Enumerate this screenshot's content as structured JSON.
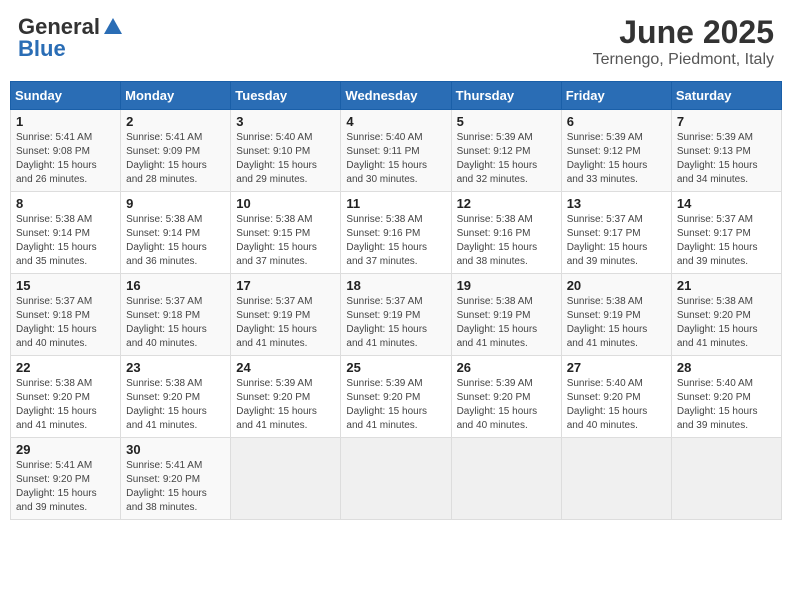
{
  "logo": {
    "general": "General",
    "blue": "Blue"
  },
  "title": "June 2025",
  "location": "Ternengo, Piedmont, Italy",
  "days_header": [
    "Sunday",
    "Monday",
    "Tuesday",
    "Wednesday",
    "Thursday",
    "Friday",
    "Saturday"
  ],
  "weeks": [
    [
      {
        "day": "1",
        "info": "Sunrise: 5:41 AM\nSunset: 9:08 PM\nDaylight: 15 hours\nand 26 minutes."
      },
      {
        "day": "2",
        "info": "Sunrise: 5:41 AM\nSunset: 9:09 PM\nDaylight: 15 hours\nand 28 minutes."
      },
      {
        "day": "3",
        "info": "Sunrise: 5:40 AM\nSunset: 9:10 PM\nDaylight: 15 hours\nand 29 minutes."
      },
      {
        "day": "4",
        "info": "Sunrise: 5:40 AM\nSunset: 9:11 PM\nDaylight: 15 hours\nand 30 minutes."
      },
      {
        "day": "5",
        "info": "Sunrise: 5:39 AM\nSunset: 9:12 PM\nDaylight: 15 hours\nand 32 minutes."
      },
      {
        "day": "6",
        "info": "Sunrise: 5:39 AM\nSunset: 9:12 PM\nDaylight: 15 hours\nand 33 minutes."
      },
      {
        "day": "7",
        "info": "Sunrise: 5:39 AM\nSunset: 9:13 PM\nDaylight: 15 hours\nand 34 minutes."
      }
    ],
    [
      {
        "day": "8",
        "info": "Sunrise: 5:38 AM\nSunset: 9:14 PM\nDaylight: 15 hours\nand 35 minutes."
      },
      {
        "day": "9",
        "info": "Sunrise: 5:38 AM\nSunset: 9:14 PM\nDaylight: 15 hours\nand 36 minutes."
      },
      {
        "day": "10",
        "info": "Sunrise: 5:38 AM\nSunset: 9:15 PM\nDaylight: 15 hours\nand 37 minutes."
      },
      {
        "day": "11",
        "info": "Sunrise: 5:38 AM\nSunset: 9:16 PM\nDaylight: 15 hours\nand 37 minutes."
      },
      {
        "day": "12",
        "info": "Sunrise: 5:38 AM\nSunset: 9:16 PM\nDaylight: 15 hours\nand 38 minutes."
      },
      {
        "day": "13",
        "info": "Sunrise: 5:37 AM\nSunset: 9:17 PM\nDaylight: 15 hours\nand 39 minutes."
      },
      {
        "day": "14",
        "info": "Sunrise: 5:37 AM\nSunset: 9:17 PM\nDaylight: 15 hours\nand 39 minutes."
      }
    ],
    [
      {
        "day": "15",
        "info": "Sunrise: 5:37 AM\nSunset: 9:18 PM\nDaylight: 15 hours\nand 40 minutes."
      },
      {
        "day": "16",
        "info": "Sunrise: 5:37 AM\nSunset: 9:18 PM\nDaylight: 15 hours\nand 40 minutes."
      },
      {
        "day": "17",
        "info": "Sunrise: 5:37 AM\nSunset: 9:19 PM\nDaylight: 15 hours\nand 41 minutes."
      },
      {
        "day": "18",
        "info": "Sunrise: 5:37 AM\nSunset: 9:19 PM\nDaylight: 15 hours\nand 41 minutes."
      },
      {
        "day": "19",
        "info": "Sunrise: 5:38 AM\nSunset: 9:19 PM\nDaylight: 15 hours\nand 41 minutes."
      },
      {
        "day": "20",
        "info": "Sunrise: 5:38 AM\nSunset: 9:19 PM\nDaylight: 15 hours\nand 41 minutes."
      },
      {
        "day": "21",
        "info": "Sunrise: 5:38 AM\nSunset: 9:20 PM\nDaylight: 15 hours\nand 41 minutes."
      }
    ],
    [
      {
        "day": "22",
        "info": "Sunrise: 5:38 AM\nSunset: 9:20 PM\nDaylight: 15 hours\nand 41 minutes."
      },
      {
        "day": "23",
        "info": "Sunrise: 5:38 AM\nSunset: 9:20 PM\nDaylight: 15 hours\nand 41 minutes."
      },
      {
        "day": "24",
        "info": "Sunrise: 5:39 AM\nSunset: 9:20 PM\nDaylight: 15 hours\nand 41 minutes."
      },
      {
        "day": "25",
        "info": "Sunrise: 5:39 AM\nSunset: 9:20 PM\nDaylight: 15 hours\nand 41 minutes."
      },
      {
        "day": "26",
        "info": "Sunrise: 5:39 AM\nSunset: 9:20 PM\nDaylight: 15 hours\nand 40 minutes."
      },
      {
        "day": "27",
        "info": "Sunrise: 5:40 AM\nSunset: 9:20 PM\nDaylight: 15 hours\nand 40 minutes."
      },
      {
        "day": "28",
        "info": "Sunrise: 5:40 AM\nSunset: 9:20 PM\nDaylight: 15 hours\nand 39 minutes."
      }
    ],
    [
      {
        "day": "29",
        "info": "Sunrise: 5:41 AM\nSunset: 9:20 PM\nDaylight: 15 hours\nand 39 minutes."
      },
      {
        "day": "30",
        "info": "Sunrise: 5:41 AM\nSunset: 9:20 PM\nDaylight: 15 hours\nand 38 minutes."
      },
      {
        "day": "",
        "info": ""
      },
      {
        "day": "",
        "info": ""
      },
      {
        "day": "",
        "info": ""
      },
      {
        "day": "",
        "info": ""
      },
      {
        "day": "",
        "info": ""
      }
    ]
  ]
}
